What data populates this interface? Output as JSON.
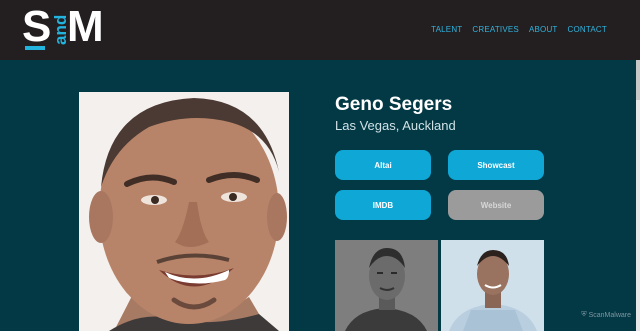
{
  "site": {
    "logo": {
      "letter_left": "S",
      "letter_right": "M",
      "middle": "and"
    }
  },
  "nav": {
    "items": [
      "TALENT",
      "CREATIVES",
      "ABOUT",
      "CONTACT"
    ]
  },
  "profile": {
    "name": "Geno Segers",
    "location": "Las Vegas, Auckland"
  },
  "buttons": {
    "altai": "Altai",
    "showcast": "Showcast",
    "imdb": "IMDB",
    "website": "Website"
  },
  "watermark": "ScanMalware",
  "colors": {
    "header_bg": "#231f20",
    "page_bg": "#033845",
    "accent": "#0fa7d6",
    "disabled": "#9b9b9b"
  }
}
